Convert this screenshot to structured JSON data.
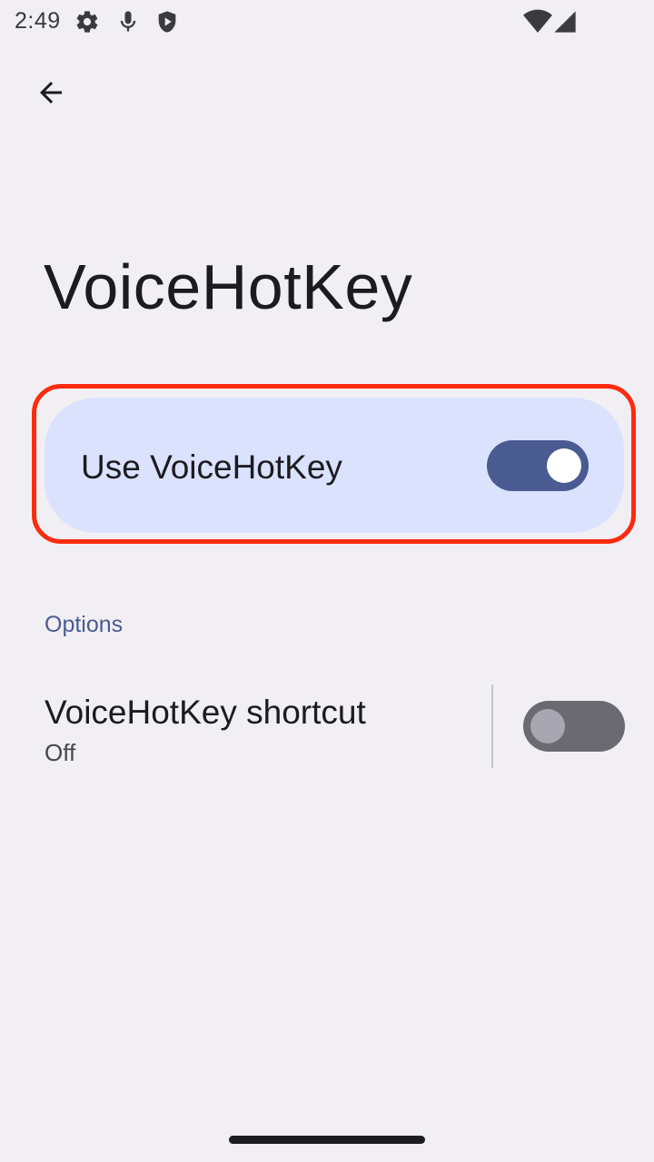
{
  "status_bar": {
    "time": "2:49",
    "icons": [
      "settings-gear-icon",
      "microphone-icon",
      "shield-play-icon",
      "wifi-icon",
      "cellular-signal-icon"
    ]
  },
  "app": {
    "title": "VoiceHotKey",
    "back_icon": "arrow-back-icon"
  },
  "main_switch": {
    "label": "Use VoiceHotKey",
    "enabled": true
  },
  "options": {
    "header": "Options",
    "items": [
      {
        "title": "VoiceHotKey shortcut",
        "summary": "Off",
        "enabled": false
      }
    ]
  },
  "colors": {
    "background": "#f2eff4",
    "card": "#dae2fe",
    "accent": "#4a5b92",
    "highlight": "#ff2a0f"
  }
}
